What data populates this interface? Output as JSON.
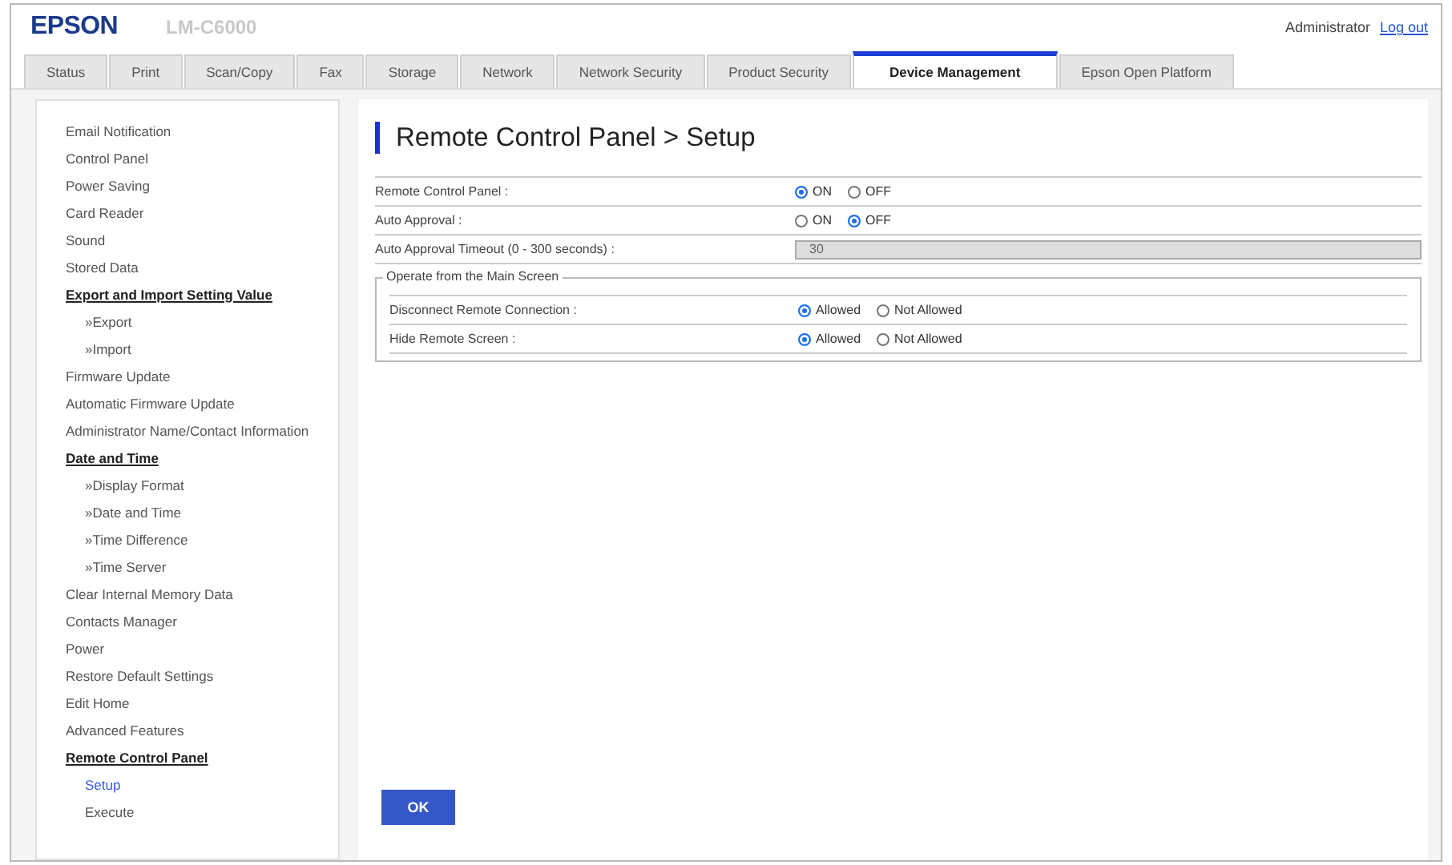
{
  "header": {
    "logo": "EPSON",
    "model": "LM-C6000",
    "user": "Administrator",
    "logout": "Log out"
  },
  "tabs": [
    {
      "label": "Status",
      "selected": false
    },
    {
      "label": "Print",
      "selected": false
    },
    {
      "label": "Scan/Copy",
      "selected": false
    },
    {
      "label": "Fax",
      "selected": false
    },
    {
      "label": "Storage",
      "selected": false
    },
    {
      "label": "Network",
      "selected": false
    },
    {
      "label": "Network Security",
      "selected": false
    },
    {
      "label": "Product Security",
      "selected": false
    },
    {
      "label": "Device Management",
      "selected": true
    },
    {
      "label": "Epson Open Platform",
      "selected": false
    }
  ],
  "sidebar": {
    "items": [
      {
        "kind": "item",
        "label": "Email Notification",
        "selected": false
      },
      {
        "kind": "item",
        "label": "Control Panel",
        "selected": false
      },
      {
        "kind": "item",
        "label": "Power Saving",
        "selected": false
      },
      {
        "kind": "item",
        "label": "Card Reader",
        "selected": false
      },
      {
        "kind": "item",
        "label": "Sound",
        "selected": false
      },
      {
        "kind": "item",
        "label": "Stored Data",
        "selected": false
      },
      {
        "kind": "heading",
        "label": "Export and Import Setting Value",
        "selected": false
      },
      {
        "kind": "sub",
        "label": "»Export",
        "selected": false
      },
      {
        "kind": "sub",
        "label": "»Import",
        "selected": false
      },
      {
        "kind": "item",
        "label": "Firmware Update",
        "selected": false
      },
      {
        "kind": "item",
        "label": "Automatic Firmware Update",
        "selected": false
      },
      {
        "kind": "item",
        "label": "Administrator Name/Contact Information",
        "selected": false
      },
      {
        "kind": "heading",
        "label": "Date and Time",
        "selected": false
      },
      {
        "kind": "sub",
        "label": "»Display Format",
        "selected": false
      },
      {
        "kind": "sub",
        "label": "»Date and Time",
        "selected": false
      },
      {
        "kind": "sub",
        "label": "»Time Difference",
        "selected": false
      },
      {
        "kind": "sub",
        "label": "»Time Server",
        "selected": false
      },
      {
        "kind": "item",
        "label": "Clear Internal Memory Data",
        "selected": false
      },
      {
        "kind": "item",
        "label": "Contacts Manager",
        "selected": false
      },
      {
        "kind": "item",
        "label": "Power",
        "selected": false
      },
      {
        "kind": "item",
        "label": "Restore Default Settings",
        "selected": false
      },
      {
        "kind": "item",
        "label": "Edit Home",
        "selected": false
      },
      {
        "kind": "item",
        "label": "Advanced Features",
        "selected": false
      },
      {
        "kind": "heading",
        "label": "Remote Control Panel",
        "selected": false
      },
      {
        "kind": "sub",
        "label": "Setup",
        "selected": true
      },
      {
        "kind": "sub",
        "label": "Execute",
        "selected": false
      }
    ]
  },
  "page_title": "Remote Control Panel > Setup",
  "settings": [
    {
      "kind": "radio",
      "label": "Remote Control Panel :",
      "options": [
        {
          "label": "ON",
          "selected": true
        },
        {
          "label": "OFF",
          "selected": false
        }
      ]
    },
    {
      "kind": "radio",
      "label": "Auto Approval :",
      "options": [
        {
          "label": "ON",
          "selected": false
        },
        {
          "label": "OFF",
          "selected": true
        }
      ]
    },
    {
      "kind": "field",
      "label": "Auto Approval Timeout (0 - 300 seconds) :",
      "value": "30",
      "disabled": true
    }
  ],
  "group": {
    "legend": "Operate from the Main Screen",
    "settings": [
      {
        "kind": "radio",
        "label": "Disconnect Remote Connection :",
        "options": [
          {
            "label": "Allowed",
            "selected": true
          },
          {
            "label": "Not Allowed",
            "selected": false
          }
        ]
      },
      {
        "kind": "radio",
        "label": "Hide Remote Screen :",
        "options": [
          {
            "label": "Allowed",
            "selected": true
          },
          {
            "label": "Not Allowed",
            "selected": false
          }
        ]
      }
    ]
  },
  "ok_button": "OK"
}
